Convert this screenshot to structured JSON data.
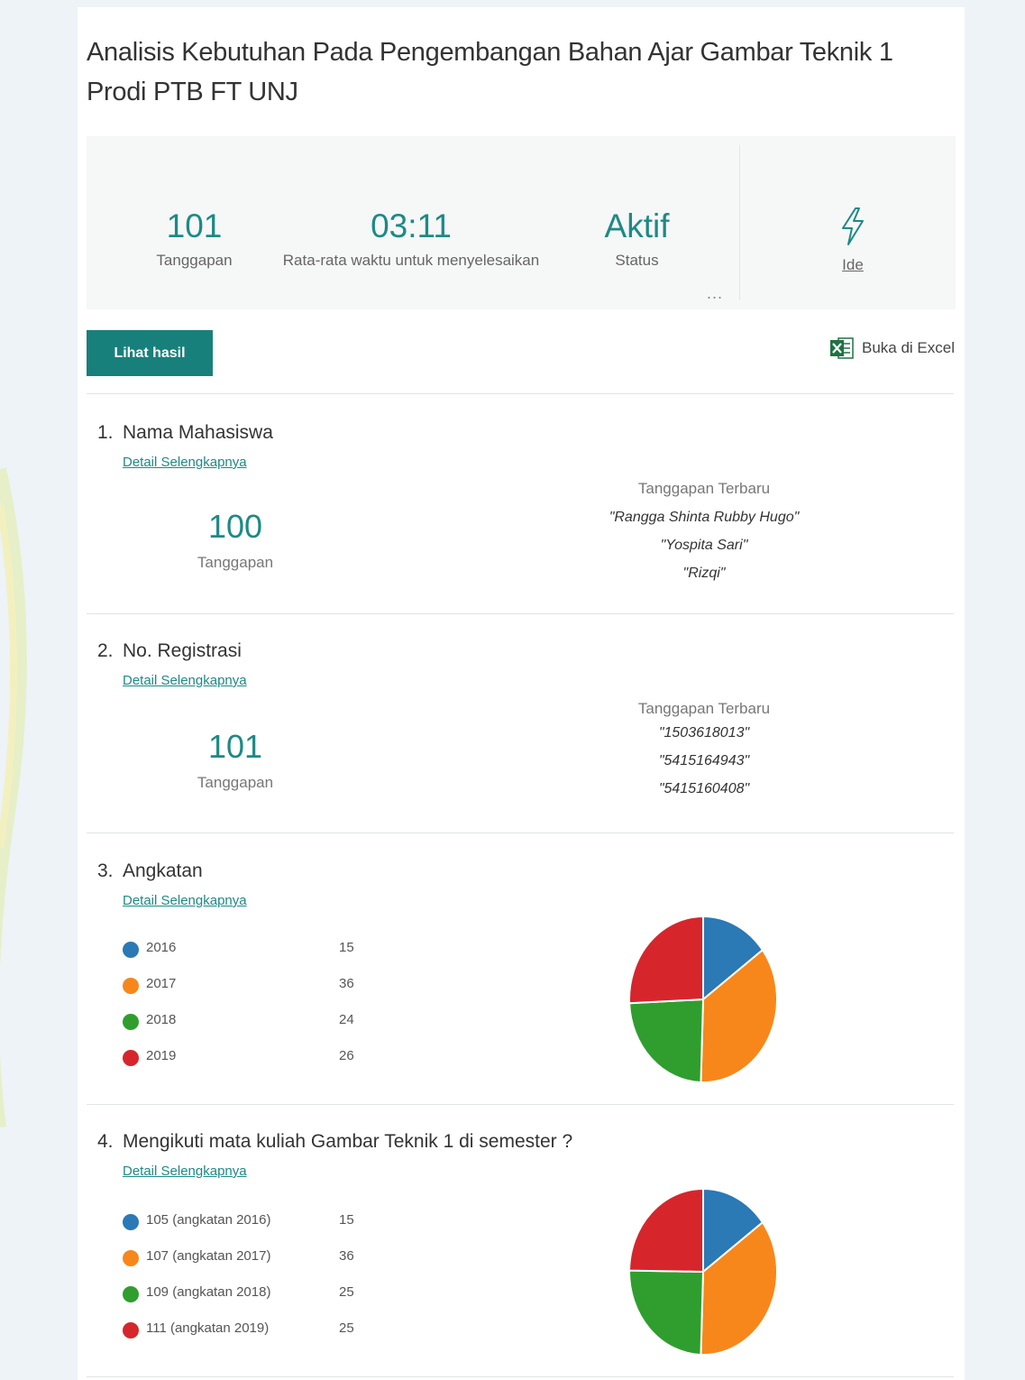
{
  "form": {
    "title": "Analisis Kebutuhan Pada Pengembangan Bahan Ajar Gambar Teknik 1 Prodi PTB FT UNJ"
  },
  "summary": {
    "responses": {
      "value": "101",
      "label": "Tanggapan"
    },
    "avg_time": {
      "value": "03:11",
      "label": "Rata-rata waktu untuk menyelesaikan"
    },
    "status": {
      "value": "Aktif",
      "label": "Status"
    },
    "ideas": {
      "icon": "lightning-icon",
      "label": "Ide"
    },
    "more_label": "..."
  },
  "toolbar": {
    "view_results_label": "Lihat hasil",
    "open_excel_label": "Buka di Excel",
    "excel_icon": "excel-icon"
  },
  "questions": [
    {
      "number": "1.",
      "title": "Nama Mahasiswa",
      "details_link": "Detail Selengkapnya",
      "responses_value": "100",
      "responses_label": "Tanggapan",
      "latest_header": "Tanggapan Terbaru",
      "latest": [
        "\"Rangga Shinta Rubby Hugo\"",
        "\"Yospita Sari\"",
        "\"Rizqi\""
      ]
    },
    {
      "number": "2.",
      "title": "No. Registrasi",
      "details_link": "Detail Selengkapnya",
      "responses_value": "101",
      "responses_label": "Tanggapan",
      "latest_header": "Tanggapan Terbaru",
      "latest": [
        "\"1503618013\"",
        "\"5415164943\"",
        "\"5415160408\""
      ]
    },
    {
      "number": "3.",
      "title": "Angkatan",
      "details_link": "Detail Selengkapnya"
    },
    {
      "number": "4.",
      "title": "Mengikuti mata kuliah Gambar Teknik 1 di semester ?",
      "details_link": "Detail Selengkapnya"
    }
  ],
  "colors": {
    "accent": "#18807b",
    "blue": "#2b79b5",
    "orange": "#f7871b",
    "green": "#2f9e2e",
    "red": "#d6262b"
  },
  "chart_data": [
    {
      "type": "pie",
      "categories": [
        "2016",
        "2017",
        "2018",
        "2019"
      ],
      "values": [
        15,
        36,
        24,
        26
      ],
      "colors": [
        "#2b79b5",
        "#f7871b",
        "#2f9e2e",
        "#d6262b"
      ]
    },
    {
      "type": "pie",
      "categories": [
        "105 (angkatan 2016)",
        "107 (angkatan 2017)",
        "109 (angkatan 2018)",
        "111 (angkatan 2019)"
      ],
      "values": [
        15,
        36,
        25,
        25
      ],
      "colors": [
        "#2b79b5",
        "#f7871b",
        "#2f9e2e",
        "#d6262b"
      ]
    }
  ]
}
